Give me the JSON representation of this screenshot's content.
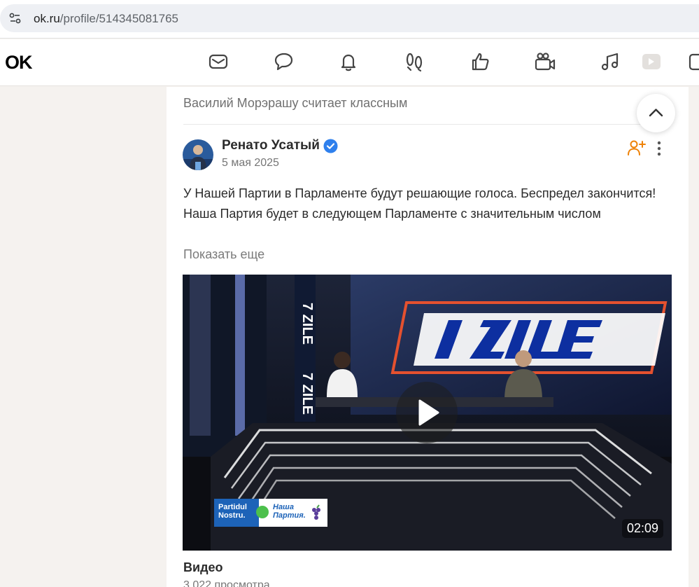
{
  "browser": {
    "url_host": "ok.ru",
    "url_path": "/profile/514345081765"
  },
  "topnav": {
    "logo": "OK",
    "icons": [
      "mail-icon",
      "chat-bubble-icon",
      "bell-icon",
      "guests-footprints-icon",
      "thumbs-up-icon",
      "video-camera-icon",
      "music-note-icon",
      "video-play-icon",
      "calendar-icon"
    ]
  },
  "feed": {
    "liked_by": "Василий Морэрашу считает классным",
    "post": {
      "author": "Ренато Усатый",
      "verified": true,
      "date": "5 мая 2025",
      "text_lines": [
        "У Нашей Партии в Парламенте будут решающие голоса. Беспредел закончится!",
        "Наша Партия будет в следующем Парламенте с значительным числом"
      ],
      "show_more": "Показать еще",
      "video": {
        "duration": "02:09",
        "studio_logo": "7ZILE",
        "banner_left": "Partidul Nostru.",
        "banner_right": "Наша Партия."
      },
      "attachment_title": "Видео",
      "views": "3 022 просмотра"
    }
  },
  "colors": {
    "accent_orange": "#ee8208",
    "verified_blue": "#2f80ed",
    "background": "#f5f2ef"
  }
}
